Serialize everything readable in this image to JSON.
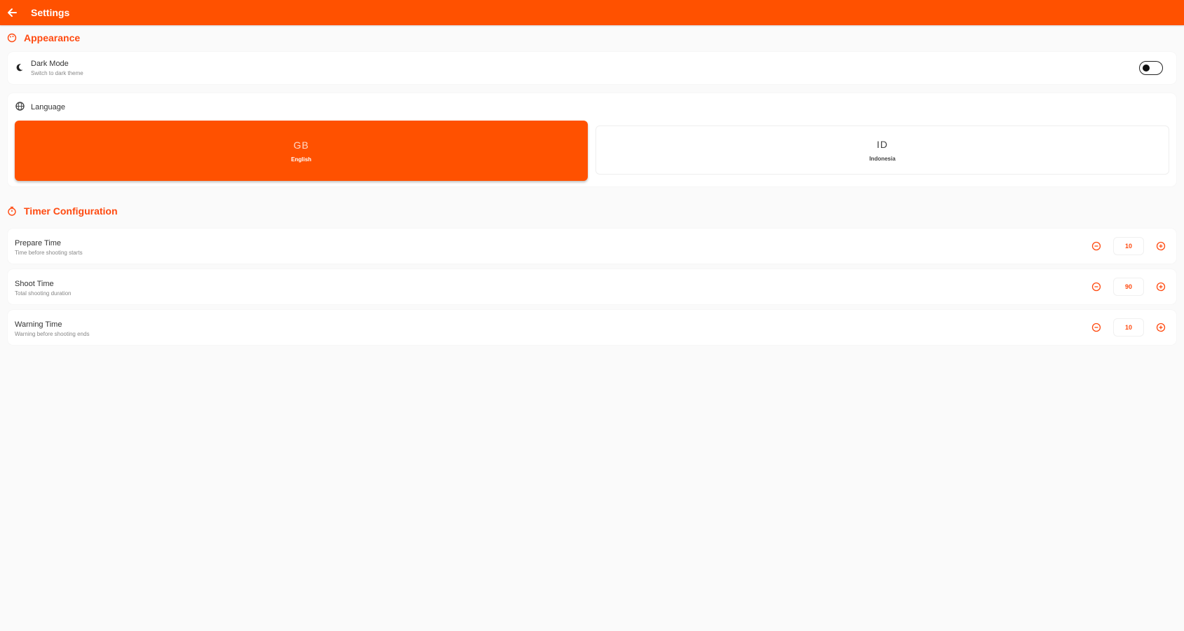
{
  "appbar": {
    "title": "Settings",
    "back_icon": "arrow-left-icon"
  },
  "appearance": {
    "heading": "Appearance",
    "icon": "palette-icon",
    "dark_mode": {
      "title": "Dark Mode",
      "subtitle": "Switch to dark theme",
      "enabled": false,
      "icon": "moon-icon"
    },
    "language": {
      "label": "Language",
      "icon": "globe-icon",
      "options": [
        {
          "code": "GB",
          "name": "English",
          "selected": true
        },
        {
          "code": "ID",
          "name": "Indonesia",
          "selected": false
        }
      ]
    }
  },
  "timer": {
    "heading": "Timer Configuration",
    "icon": "timer-icon",
    "items": [
      {
        "title": "Prepare Time",
        "subtitle": "Time before shooting starts",
        "value": "10"
      },
      {
        "title": "Shoot Time",
        "subtitle": "Total shooting duration",
        "value": "90"
      },
      {
        "title": "Warning Time",
        "subtitle": "Warning before shooting ends",
        "value": "10"
      }
    ]
  },
  "colors": {
    "accent": "#ff5100",
    "background": "#fafafa",
    "card": "#ffffff"
  }
}
